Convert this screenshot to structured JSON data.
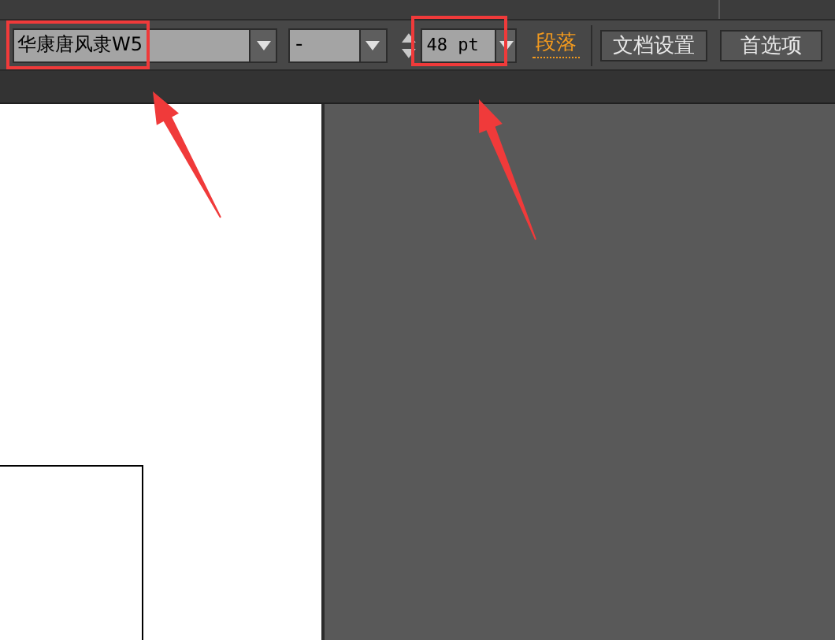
{
  "toolbar": {
    "font_family": {
      "value": "华康唐风隶W5"
    },
    "font_style": {
      "value": "-"
    },
    "font_size": {
      "value": "48 pt"
    },
    "paragraph_link": {
      "label": "段落"
    },
    "buttons": [
      "文档设置",
      "首选项"
    ]
  },
  "annotations": [
    {
      "kind": "box-arrow"
    },
    {
      "kind": "box-arrow"
    }
  ]
}
